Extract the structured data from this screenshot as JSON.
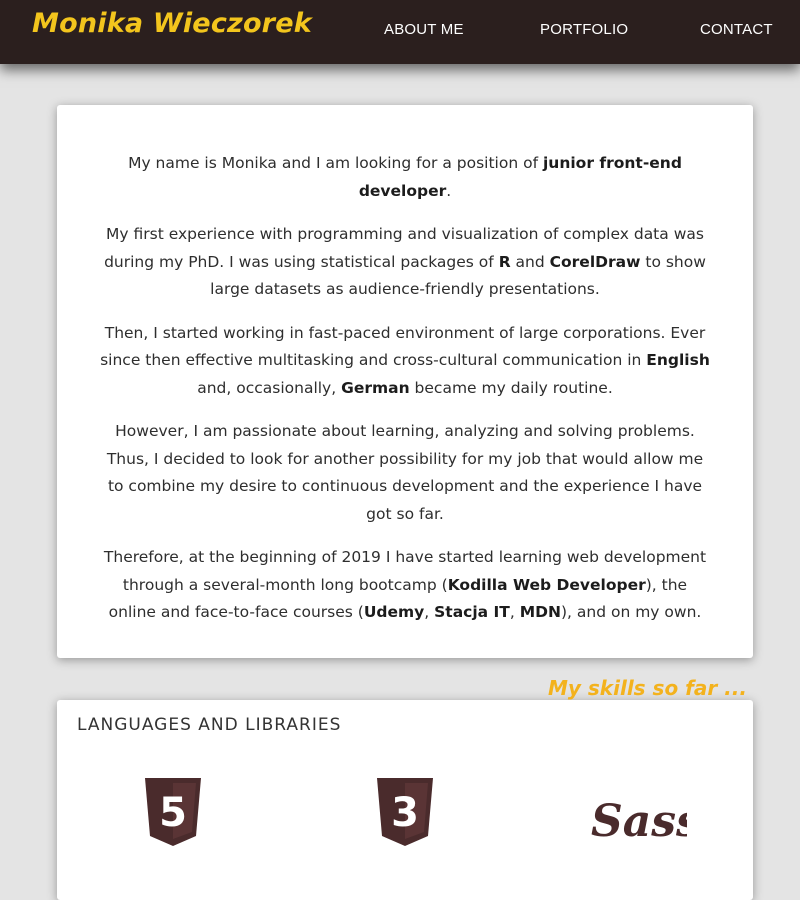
{
  "header": {
    "brand": "Monika Wieczorek",
    "nav": [
      {
        "label": "ABOUT ME"
      },
      {
        "label": "PORTFOLIO"
      },
      {
        "label": "CONTACT"
      }
    ]
  },
  "about": {
    "paragraphs": [
      [
        {
          "text": "My name is Monika and I am looking for a position of ",
          "bold": false
        },
        {
          "text": "junior front-end developer",
          "bold": true
        },
        {
          "text": ".",
          "bold": false
        }
      ],
      [
        {
          "text": "My first experience with programming and visualization of complex data was during my PhD. I was using statistical packages of ",
          "bold": false
        },
        {
          "text": "R",
          "bold": true
        },
        {
          "text": " and ",
          "bold": false
        },
        {
          "text": "CorelDraw",
          "bold": true
        },
        {
          "text": " to show large datasets as audience-friendly presentations.",
          "bold": false
        }
      ],
      [
        {
          "text": "Then, I started working in fast-paced environment of large corporations. Ever since then effective multitasking and cross-cultural communication in ",
          "bold": false
        },
        {
          "text": "English",
          "bold": true
        },
        {
          "text": " and, occasionally, ",
          "bold": false
        },
        {
          "text": "German",
          "bold": true
        },
        {
          "text": " became my daily routine.",
          "bold": false
        }
      ],
      [
        {
          "text": "However, I am passionate about learning, analyzing and solving problems. Thus, I decided to look for another possibility for my job that would allow me to combine my desire to continuous development and the experience I have got so far.",
          "bold": false
        }
      ],
      [
        {
          "text": "Therefore, at the beginning of 2019 I have started learning web development through a several-month long bootcamp (",
          "bold": false
        },
        {
          "text": "Kodilla Web Developer",
          "bold": true
        },
        {
          "text": "), the online and face-to-face courses (",
          "bold": false
        },
        {
          "text": "Udemy",
          "bold": true
        },
        {
          "text": ", ",
          "bold": false
        },
        {
          "text": "Stacja IT",
          "bold": true
        },
        {
          "text": ", ",
          "bold": false
        },
        {
          "text": "MDN",
          "bold": true
        },
        {
          "text": "), and on my own.",
          "bold": false
        }
      ]
    ]
  },
  "skills": {
    "tag": "My skills so far ...",
    "heading": "LANGUAGES AND LIBRARIES",
    "logos": [
      {
        "icon": "html5-icon",
        "glyph": "5"
      },
      {
        "icon": "css3-icon",
        "glyph": "3"
      },
      {
        "icon": "sass-icon",
        "glyph": "Sass"
      }
    ]
  },
  "colors": {
    "header_bg": "#2b1f1e",
    "brand": "#f3c51d",
    "tag": "#f3b21d",
    "page_bg": "#e4e4e4",
    "logo": "#4a2b2c"
  }
}
